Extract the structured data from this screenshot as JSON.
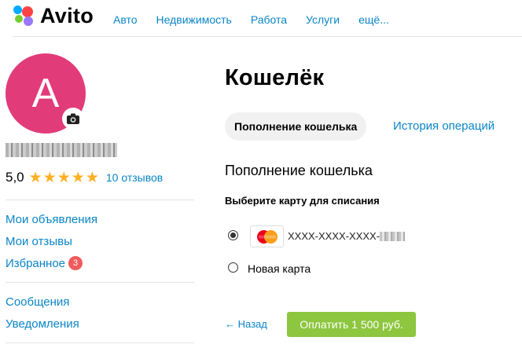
{
  "header": {
    "logo": "Avito",
    "nav": [
      "Авто",
      "Недвижимость",
      "Работа",
      "Услуги",
      "ещё..."
    ]
  },
  "profile": {
    "avatar_letter": "A",
    "rating": "5,0",
    "stars": 5,
    "reviews": "10 отзывов"
  },
  "menu": {
    "group1": [
      {
        "label": "Мои объявления"
      },
      {
        "label": "Мои отзывы"
      },
      {
        "label": "Избранное",
        "badge": "3"
      }
    ],
    "group2": [
      {
        "label": "Сообщения"
      },
      {
        "label": "Уведомления"
      }
    ]
  },
  "wallet": {
    "title": "Кошелёк",
    "tab_active": "Пополнение кошелька",
    "tab_history": "История операций",
    "subtitle": "Пополнение кошелька",
    "choose_label": "Выберите карту для списания",
    "card_number": "XXXX-XXXX-XXXX-",
    "card_brand": "MasterCard",
    "new_card": "Новая карта",
    "back": "← Назад",
    "pay_button": "Оплатить 1 500 руб."
  },
  "colors": {
    "link": "#0a85c6",
    "avatar": "#e23b7a",
    "star": "#ffb021",
    "button": "#8dc63f",
    "badge": "#f05b5b"
  }
}
